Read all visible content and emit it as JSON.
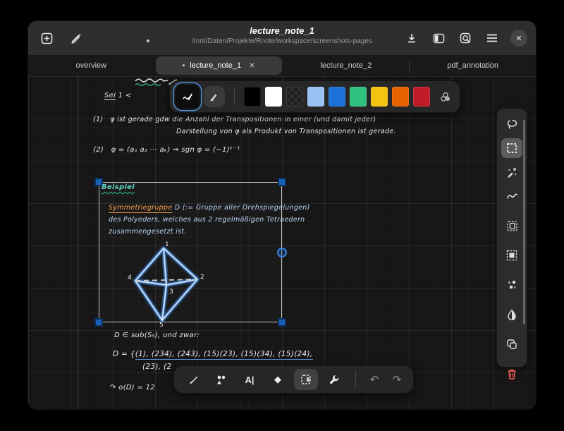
{
  "window": {
    "title": "lecture_note_1",
    "subtitle": "/mnt/Daten/Projekte/Rnote/workspace/screenshots-pages",
    "unsaved_indicator": "•",
    "close_glyph": "✕"
  },
  "tabs": {
    "t0": {
      "label": "overview"
    },
    "t1": {
      "label": "lecture_note_1",
      "dot": "•",
      "close": "✕",
      "active": "true"
    },
    "t2": {
      "label": "lecture_note_2"
    },
    "t3": {
      "label": "pdf_annotation"
    }
  },
  "pen_toolbar": {
    "colors": {
      "c0": "#000000",
      "c1": "#ffffff",
      "c2": "transparent",
      "c3": "#99c1f1",
      "c4": "#1c71d8",
      "c5": "#2ec27e",
      "c6": "#f5c211",
      "c7": "#e66100",
      "c8": "#c01c28"
    },
    "selected_tool": "stroke-color"
  },
  "notes": {
    "sei_word": "Sei",
    "sei_rest": " 1 <",
    "line1_no": "(1)",
    "line1a": "φ ist gerade gdw die Anzahl der Transpositionen in einer (und damit jeder)",
    "line1b": "Darstellung von φ als Produkt von Transpositionen ist gerade.",
    "line2_no": "(2)",
    "line2": "φ = (a₁ a₂ ⋯ aₖ)  ⇒  sgn φ = (−1)ᵏ⁻¹",
    "beispiel": "Beispiel",
    "sym_word": "Symmetriegruppe",
    "sym_rest": " D  (:= Gruppe aller Drehspiegelungen)",
    "sym_line2": "des Polyeders, welches aus 2 regelmäßigen Tetraedern",
    "sym_line3": "zusammengesetzt ist.",
    "sub_line": "D ∈ sub(S₅), und zwar:",
    "set_prefix": "D = {",
    "set_items": "(1), (234), (243), (15)(23), (15)(34), (15)(24),",
    "set_line2": "(23), (2",
    "order_line": "↷ o(D) = 12",
    "oct": {
      "v1": "1",
      "v2": "2",
      "v3": "3",
      "v4": "4",
      "v5": "5"
    }
  },
  "bottom_toolbar": {
    "typewriter_label": "A|",
    "eraser_glyph": "◆",
    "undo_glyph": "↶",
    "redo_glyph": "↷",
    "selected_pen": "selector"
  },
  "status_colors": {
    "accent_blue": "#3584e4",
    "selection_handle": "#1a5fb4",
    "delete_red": "#f66151",
    "ink_orange": "#ffa348",
    "ink_teal": "#5fd0c0",
    "ink_blue": "#99c1f1"
  }
}
